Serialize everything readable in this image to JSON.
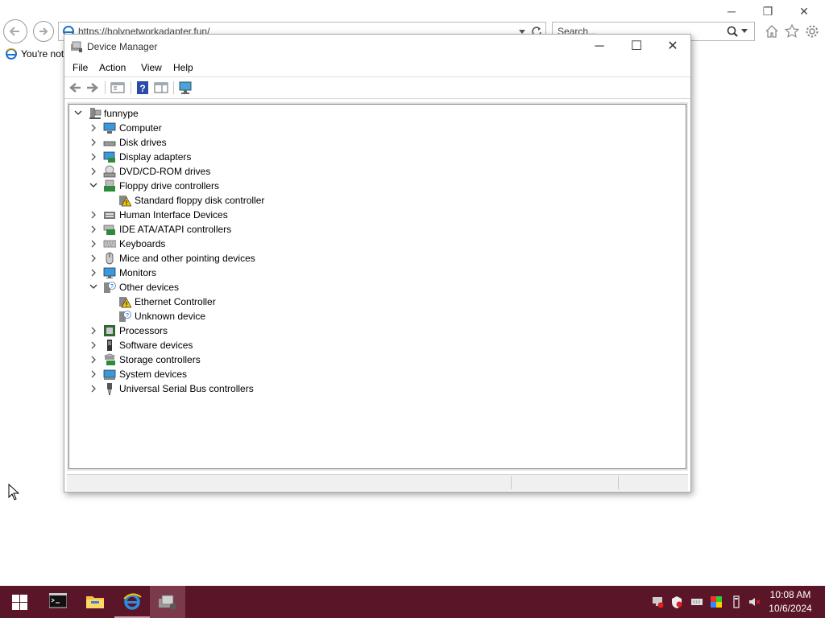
{
  "browser": {
    "url": "https://holynetworkadapter.fun/",
    "search_placeholder": "Search...",
    "tab_label": "You're not",
    "caption": {
      "minimize": "─",
      "restore": "❐",
      "close": "✕"
    }
  },
  "window": {
    "title": "Device Manager",
    "caption": {
      "minimize": "─",
      "maximize": "☐",
      "close": "✕"
    },
    "menu": [
      "File",
      "Action",
      "View",
      "Help"
    ]
  },
  "tree": {
    "root": "funnype",
    "items": [
      {
        "label": "Computer",
        "icon": "computer-icon",
        "expanded": false
      },
      {
        "label": "Disk drives",
        "icon": "disk-drive-icon",
        "expanded": false
      },
      {
        "label": "Display adapters",
        "icon": "display-adapter-icon",
        "expanded": false
      },
      {
        "label": "DVD/CD-ROM drives",
        "icon": "dvd-drive-icon",
        "expanded": false
      },
      {
        "label": "Floppy drive controllers",
        "icon": "floppy-controller-icon",
        "expanded": true
      },
      {
        "label": "Standard floppy disk controller",
        "icon": "warning-device-icon",
        "child": true
      },
      {
        "label": "Human Interface Devices",
        "icon": "hid-icon",
        "expanded": false
      },
      {
        "label": "IDE ATA/ATAPI controllers",
        "icon": "ide-controller-icon",
        "expanded": false
      },
      {
        "label": "Keyboards",
        "icon": "keyboard-icon",
        "expanded": false
      },
      {
        "label": "Mice and other pointing devices",
        "icon": "mouse-icon",
        "expanded": false
      },
      {
        "label": "Monitors",
        "icon": "monitor-icon",
        "expanded": false
      },
      {
        "label": "Other devices",
        "icon": "unknown-device-icon",
        "expanded": true
      },
      {
        "label": "Ethernet Controller",
        "icon": "warning-device-icon",
        "child": true
      },
      {
        "label": "Unknown device",
        "icon": "unknown-device-icon",
        "child": true
      },
      {
        "label": "Processors",
        "icon": "processor-icon",
        "expanded": false
      },
      {
        "label": "Software devices",
        "icon": "software-device-icon",
        "expanded": false
      },
      {
        "label": "Storage controllers",
        "icon": "storage-controller-icon",
        "expanded": false
      },
      {
        "label": "System devices",
        "icon": "system-device-icon",
        "expanded": false
      },
      {
        "label": "Universal Serial Bus controllers",
        "icon": "usb-icon",
        "expanded": false
      }
    ]
  },
  "taskbar": {
    "time": "10:08 AM",
    "date": "10/6/2024",
    "color": "#5a1628"
  }
}
